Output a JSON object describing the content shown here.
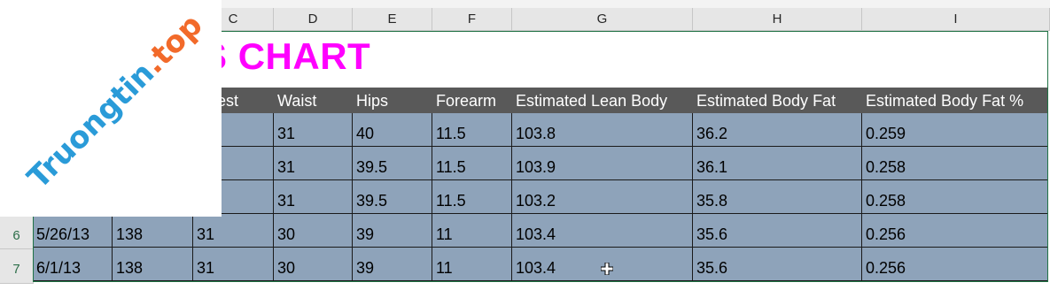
{
  "column_headers": [
    "C",
    "D",
    "E",
    "F",
    "G",
    "H",
    "I"
  ],
  "row_headers": [
    "6",
    "7"
  ],
  "title": "ROGRESS CHART",
  "table": {
    "headers": [
      "est",
      "Waist",
      "Hips",
      "Forearm",
      "Estimated Lean Body",
      "Estimated Body Fat",
      "Estimated Body Fat %"
    ],
    "rows": [
      [
        "",
        "",
        "",
        "31",
        "40",
        "11.5",
        "103.8",
        "36.2",
        "0.259"
      ],
      [
        "",
        "",
        "",
        "31",
        "39.5",
        "11.5",
        "103.9",
        "36.1",
        "0.258"
      ],
      [
        "",
        "",
        "",
        "31",
        "39.5",
        "11.5",
        "103.2",
        "35.8",
        "0.258"
      ],
      [
        "5/26/13",
        "138",
        "31",
        "30",
        "39",
        "11",
        "103.4",
        "35.6",
        "0.256"
      ],
      [
        "6/1/13",
        "138",
        "31",
        "30",
        "39",
        "11",
        "103.4",
        "35.6",
        "0.256"
      ]
    ]
  },
  "watermark": {
    "part1": "Truongtin",
    "part2": ".top"
  },
  "colors": {
    "title": "#ff00ff",
    "header_bg": "#595959",
    "row_bg": "#8ea3ba",
    "selection": "#217346"
  }
}
